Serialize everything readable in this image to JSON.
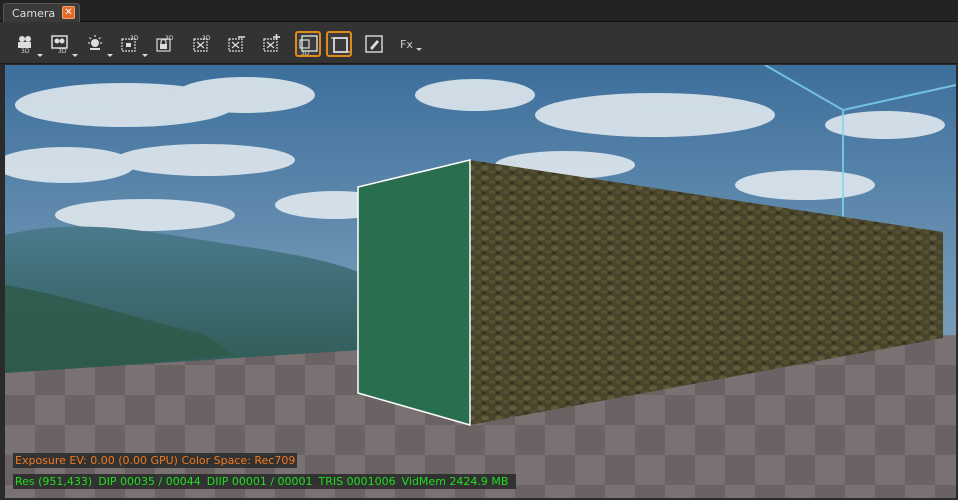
{
  "tab": {
    "label": "Camera",
    "close_glyph": "✕"
  },
  "toolbar": {
    "buttons": [
      {
        "name": "camera-3d-button",
        "icon": "camera-3d-icon",
        "has_dropdown": true,
        "active": false
      },
      {
        "name": "scene-camera-3d-button",
        "icon": "scene-camera-3d-icon",
        "has_dropdown": true,
        "active": false
      },
      {
        "name": "light-button",
        "icon": "light-icon",
        "has_dropdown": true,
        "active": false
      },
      {
        "name": "object-3d-button",
        "icon": "object-3d-icon",
        "has_dropdown": true,
        "active": false
      },
      {
        "name": "lock-3d-button",
        "icon": "lock-3d-icon",
        "has_dropdown": false,
        "active": false
      },
      {
        "name": "expand-3d-button",
        "icon": "expand-3d-icon",
        "has_dropdown": false,
        "active": false
      },
      {
        "name": "remove-button",
        "icon": "remove-icon",
        "has_dropdown": false,
        "active": false
      },
      {
        "name": "add-button",
        "icon": "add-icon",
        "has_dropdown": false,
        "active": false
      },
      {
        "name": "view-3d-toggle",
        "icon": "view-3d-icon",
        "has_dropdown": false,
        "active": true
      },
      {
        "name": "frame-toggle",
        "icon": "frame-icon",
        "has_dropdown": false,
        "active": true
      },
      {
        "name": "edit-button",
        "icon": "edit-icon",
        "has_dropdown": false,
        "active": false
      }
    ],
    "fx_label": "Fx"
  },
  "overlay": {
    "exposure": "Exposure EV: 0.00 (0.00 GPU)  Color Space: Rec709",
    "res": "Res (951,433)",
    "dip": "DIP 00035 / 00044",
    "diip": "DIIP 00001 / 00001",
    "tris": "TRIS 0001006",
    "vidmem": "VidMem 2424.9 MB"
  },
  "colors": {
    "accent": "#e08a1e",
    "exposure_text": "#f07a1e",
    "stats_text": "#1ee01e",
    "tab_close": "#e46a2a",
    "wall_face": "#2a6e50"
  }
}
